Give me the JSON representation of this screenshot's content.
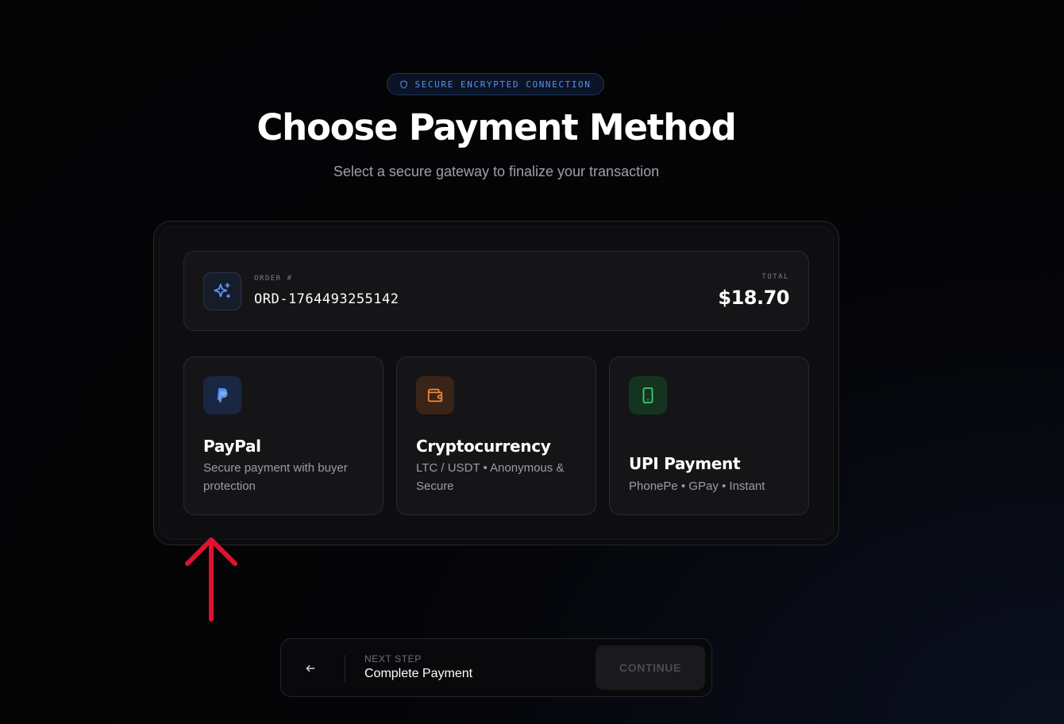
{
  "badge": {
    "text": "SECURE ENCRYPTED CONNECTION",
    "icon": "shield-icon",
    "color": "#5b8ef0"
  },
  "header": {
    "title": "Choose Payment Method",
    "subtitle": "Select a secure gateway to finalize your transaction"
  },
  "order": {
    "label": "ORDER #",
    "id": "ORD-1764493255142",
    "total_label": "TOTAL",
    "total_value": "$18.70",
    "icon": "sparkle-icon"
  },
  "methods": [
    {
      "name": "PayPal",
      "description": "Secure payment with buyer protection",
      "icon": "paypal-icon",
      "accent": "#4f8ff7"
    },
    {
      "name": "Cryptocurrency",
      "description": "LTC / USDT • Anonymous & Secure",
      "icon": "wallet-icon",
      "accent": "#f0883e"
    },
    {
      "name": "UPI Payment",
      "description": "PhonePe • GPay • Instant",
      "icon": "phone-icon",
      "accent": "#3ecf6e"
    }
  ],
  "annotation": {
    "icon": "red-arrow-icon",
    "color": "#e0122e"
  },
  "footer": {
    "next_label": "NEXT STEP",
    "next_value": "Complete Payment",
    "continue_label": "CONTINUE",
    "back_icon": "arrow-left-icon"
  }
}
